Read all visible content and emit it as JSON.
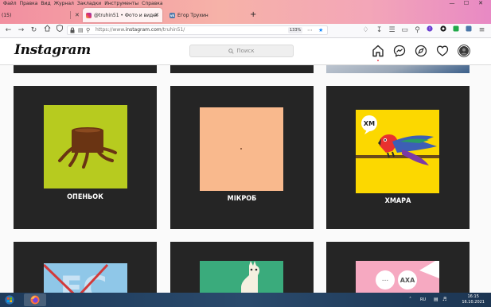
{
  "browser": {
    "menu": [
      "Файл",
      "Правка",
      "Вид",
      "Журнал",
      "Закладки",
      "Инструменты",
      "Справка"
    ],
    "window_controls": {
      "minimize": "—",
      "maximize": "☐",
      "close": "✕"
    },
    "tabs": [
      {
        "label": "(15)",
        "close": "✕"
      },
      {
        "label": "@truhin51 • Фото и видео в Ins",
        "close": "✕"
      },
      {
        "label": "Егор Трухин",
        "close": ""
      }
    ],
    "new_tab": "+",
    "url": {
      "prefix": "https://www.",
      "host": "instagram.com",
      "path": "/truhin51/"
    },
    "zoom": "133%"
  },
  "instagram": {
    "logo": "Instagram",
    "search_placeholder": "Поиск",
    "nav_icons": [
      "home-icon",
      "messenger-icon",
      "explore-icon",
      "heart-icon",
      "profile-avatar"
    ]
  },
  "posts": [
    {
      "caption": "ОПЕНЬОК",
      "bg": "#b7cb1f",
      "art": "stump"
    },
    {
      "caption": "МІКРОБ",
      "bg": "#f9b98d",
      "art": "dot"
    },
    {
      "caption": "ХМАРА",
      "bg": "#fcd800",
      "art": "parrot",
      "bubble": "ХМ"
    },
    {
      "caption": "",
      "bg": "#8fc7e8",
      "art": "letters",
      "letters": "EC"
    },
    {
      "caption": "",
      "bg": "#3aab7c",
      "art": "llama"
    },
    {
      "caption": "",
      "bg": "#f6a9c1",
      "art": "bubbles",
      "bubble_a": "...",
      "bubble_b": "АХА"
    }
  ],
  "taskbar": {
    "language": "RU",
    "time": "16:15",
    "date": "16.10.2021"
  },
  "colors": {
    "tile_bg": "#252525",
    "ig_bg": "#fafafa",
    "accent_notification": "#ed4956"
  }
}
